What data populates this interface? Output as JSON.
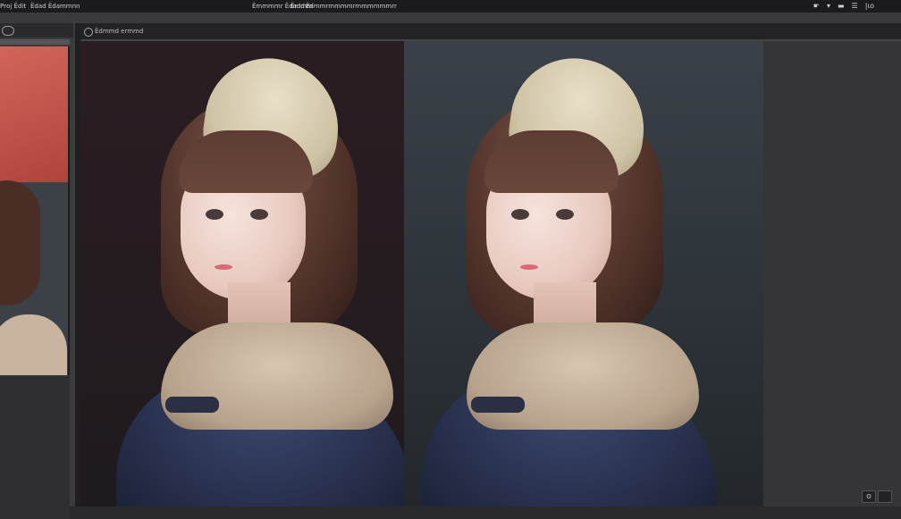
{
  "menubar": {
    "items": [
      "Рrоj Ёdit",
      "Ёdаd Ёdаmmnn"
    ],
    "center_items": [
      "Ёmmmmr Ёdаdd",
      "Ёmmm",
      "Ёdmmrmmmmrmmmmmmrr"
    ],
    "tray_icons": [
      "wifi-icon",
      "signal-icon",
      "battery-icon",
      "menu-icon",
      "clock-icon"
    ],
    "tray_labels": [
      "☛",
      "▾",
      "▬",
      "☰",
      "|ɩo"
    ]
  },
  "viewer": {
    "tab_label": "Ёdmmd ermmd",
    "left_image_desc": "",
    "right_image_desc": ""
  },
  "bottom_right": {
    "zoom_label": "ʘ"
  },
  "colors": {
    "menubar_bg": "#1b1b1d",
    "panel_bg": "#3b3b3e",
    "viewer_bg": "#333336",
    "accent_red": "#d2645a"
  }
}
